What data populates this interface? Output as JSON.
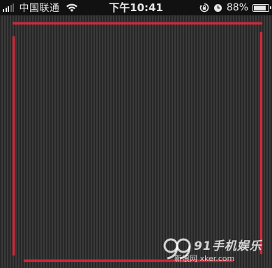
{
  "status_bar": {
    "carrier": "中国联通",
    "time": "下午10:41",
    "battery": "88%",
    "battery_level": 0.88,
    "icons": [
      "signal-icon",
      "wifi-icon",
      "rotation-lock-icon",
      "alarm-icon",
      "battery-icon"
    ]
  },
  "canvas": {
    "stroke_color": "#d0283a",
    "background": "striped-gray"
  },
  "watermark": {
    "brand": "91手机娱乐",
    "sub": "新浪网 xker.com"
  }
}
